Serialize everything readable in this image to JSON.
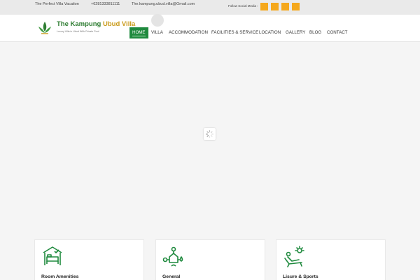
{
  "topbar": {
    "tagline": "The Perfect Villa Vacation",
    "phone": "+6281333811111",
    "email": "The.kampung.ubud.villa@Gmail.com",
    "follow_label": "Follow Social Media :",
    "social_icons": [
      "social-icon-1",
      "social-icon-2",
      "social-icon-3",
      "social-icon-4"
    ],
    "accent_color": "#f5a81c"
  },
  "header": {
    "brand_part1": "The Kampung",
    "brand_part2": "Ubud Villa",
    "brand_tagline": "Luxury Villa in Ubud With Private Pool",
    "brand_color_green": "#2e7d32",
    "brand_color_gold": "#c99a1a"
  },
  "nav": {
    "items": [
      "HOME",
      "VILLA",
      "ACCOMMODATION",
      "FACILITIES & SERVICE",
      "LOCATION",
      "GALLERY",
      "BLOG",
      "CONTACT"
    ],
    "active_index": 0,
    "active_color": "#1f8a3e"
  },
  "cards": [
    {
      "title": "Room Amenities",
      "icon": "bed-icon"
    },
    {
      "title": "General",
      "icon": "home-services-icon"
    },
    {
      "title": "Lisure & Sports",
      "icon": "sunbed-icon"
    }
  ]
}
